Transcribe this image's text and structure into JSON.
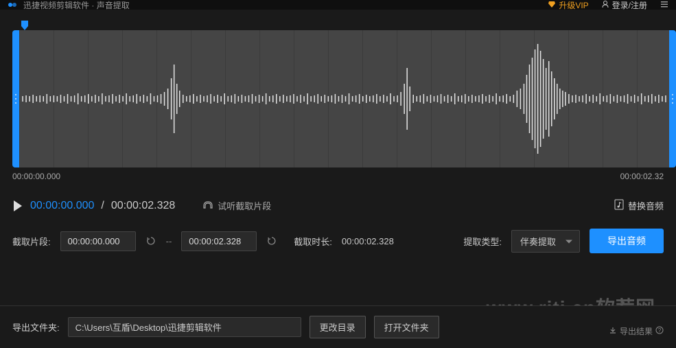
{
  "header": {
    "app_title": "迅捷视频剪辑软件",
    "subtitle": "声音提取",
    "vip_label": "升级VIP",
    "login_label": "登录/注册"
  },
  "waveform": {
    "time_start": "00:00:00.000",
    "time_end": "00:00:02.32"
  },
  "playback": {
    "current_time": "00:00:00.000",
    "total_time": "00:00:02.328",
    "preview_label": "试听截取片段",
    "replace_label": "替换音频"
  },
  "segment": {
    "label": "截取片段:",
    "start_value": "00:00:00.000",
    "end_value": "00:00:02.328",
    "duration_label": "截取时长:",
    "duration_value": "00:00:02.328"
  },
  "extract": {
    "label": "提取类型:",
    "selected": "伴奏提取"
  },
  "export": {
    "button_label": "导出音频"
  },
  "output": {
    "folder_label": "导出文件夹:",
    "folder_path": "C:\\Users\\互盾\\Desktop\\迅捷剪辑软件",
    "change_dir_label": "更改目录",
    "open_folder_label": "打开文件夹",
    "export_result_label": "导出结果"
  },
  "watermark": "www.rjtj.cn软荐网"
}
